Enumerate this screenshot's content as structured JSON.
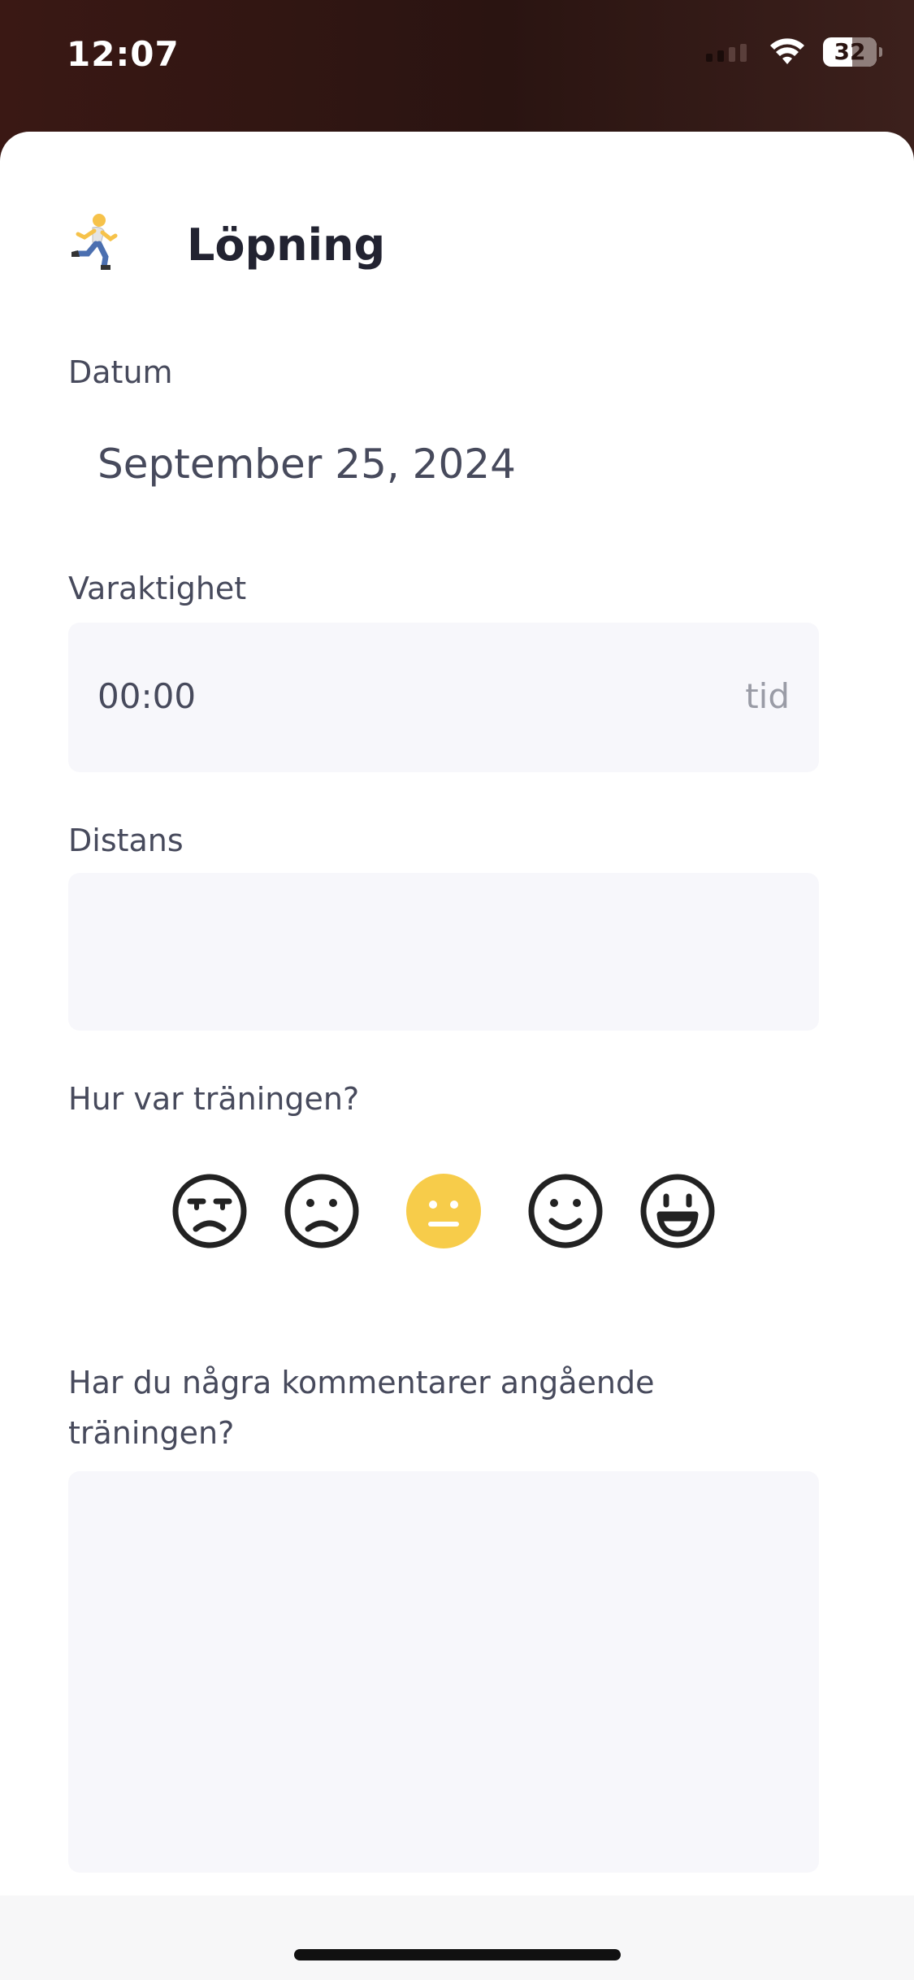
{
  "status_bar": {
    "time": "12:07",
    "battery": "32"
  },
  "header": {
    "icon": "runner-icon",
    "title": "Löpning"
  },
  "date": {
    "label": "Datum",
    "value": "September 25, 2024"
  },
  "duration": {
    "label": "Varaktighet",
    "value": "00:00",
    "suffix": "tid"
  },
  "distance": {
    "label": "Distans",
    "value": ""
  },
  "rating": {
    "label": "Hur var träningen?",
    "selected_index": 2,
    "selected_color": "#f7cc4a",
    "options": [
      "unamused-face-icon",
      "frowning-face-icon",
      "neutral-face-icon",
      "slightly-smiling-face-icon",
      "grinning-face-icon"
    ]
  },
  "comments": {
    "label_line1": "Har du några kommentarer angående",
    "label_line2": "träningen?",
    "value": ""
  }
}
